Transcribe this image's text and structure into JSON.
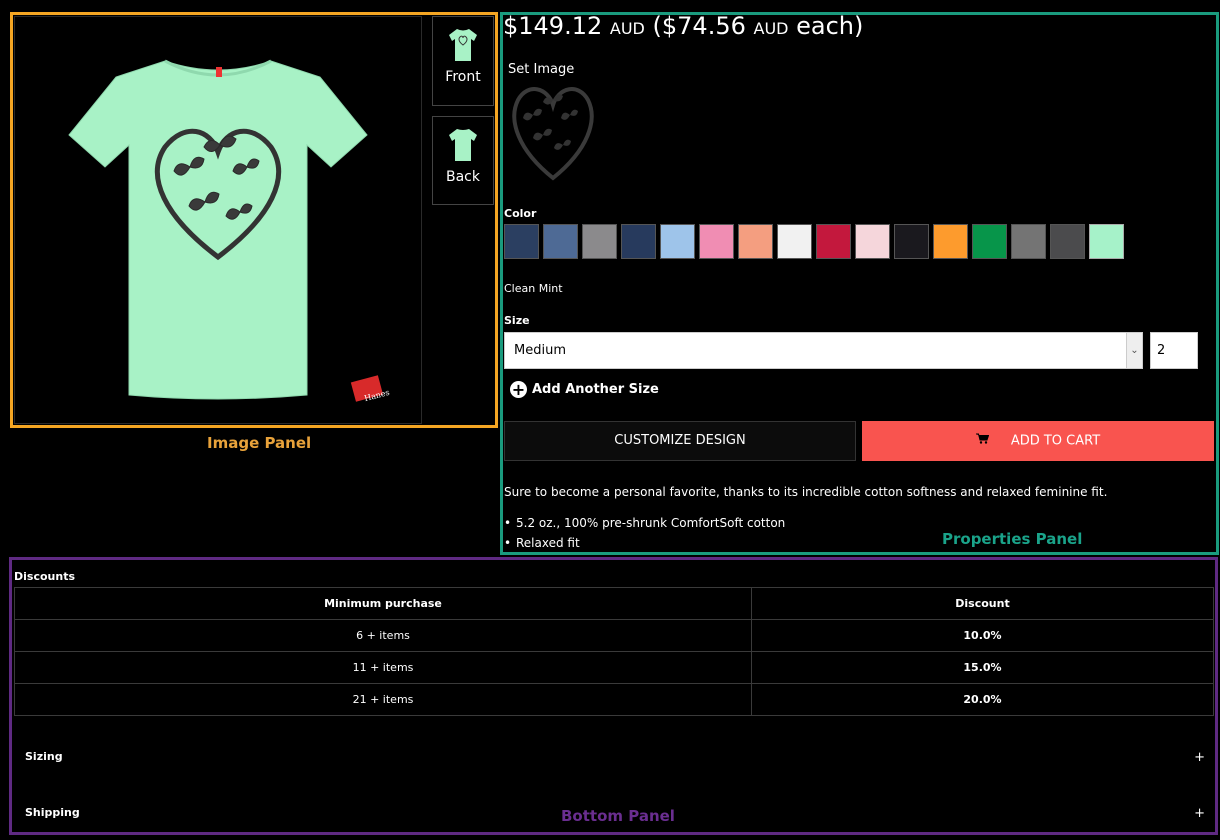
{
  "image_panel": {
    "caption": "Image Panel",
    "main_image": {
      "product": "t-shirt",
      "shirt_color": "#a8f2c6",
      "print": "heart-with-butterflies",
      "logo_text": "Hanes"
    },
    "thumbnails": [
      {
        "label": "Front"
      },
      {
        "label": "Back"
      }
    ]
  },
  "properties_panel": {
    "caption": "Properties Panel",
    "price": {
      "total": "$149.12",
      "currency": "AUD",
      "each_open": "($74.56",
      "each_currency": "AUD",
      "each_close": "each)"
    },
    "set_image_label": "Set Image",
    "color": {
      "label": "Color",
      "swatches": [
        "#2b3f61",
        "#4e6a95",
        "#8b8a8c",
        "#273a5d",
        "#9ec4ea",
        "#f08db3",
        "#f49e80",
        "#f1f1f1",
        "#c3183d",
        "#f5d6db",
        "#1a191e",
        "#fd9b2d",
        "#07954a",
        "#747474",
        "#4b4b4d",
        "#a6f2c9"
      ],
      "selected_index": 15,
      "selected_name": "Clean Mint"
    },
    "size": {
      "label": "Size",
      "selected": "Medium",
      "quantity": "2"
    },
    "add_size_label": "Add Another Size",
    "customize_label": "CUSTOMIZE DESIGN",
    "add_to_cart_label": "ADD TO CART",
    "accent_color": "#f9544f",
    "description": "Sure to become a personal favorite, thanks to its incredible cotton softness and relaxed feminine fit.",
    "bullets": [
      "5.2 oz., 100% pre-shrunk ComfortSoft cotton",
      "Relaxed fit"
    ]
  },
  "bottom_panel": {
    "caption": "Bottom Panel",
    "discounts_label": "Discounts",
    "table": {
      "headers": [
        "Minimum purchase",
        "Discount"
      ],
      "rows": [
        [
          "6 + items",
          "10.0%"
        ],
        [
          "11 + items",
          "15.0%"
        ],
        [
          "21 + items",
          "20.0%"
        ]
      ]
    },
    "sections": [
      {
        "label": "Sizing",
        "icon": "+"
      },
      {
        "label": "Shipping",
        "icon": "+"
      }
    ]
  }
}
